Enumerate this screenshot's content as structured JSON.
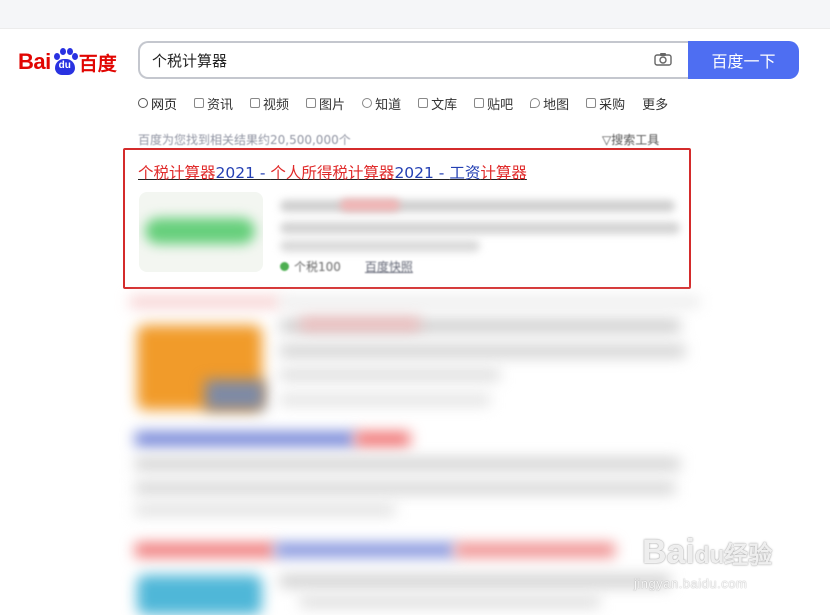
{
  "brand": {
    "logo_latin": "Bai",
    "logo_du": "du",
    "logo_cn": "百度",
    "primary_color": "#4e6ef2",
    "logo_red": "#e10602",
    "logo_blue": "#2932e1"
  },
  "search": {
    "query": "个税计算器",
    "button_label": "百度一下",
    "camera_icon": "camera-icon"
  },
  "tabs": [
    {
      "label": "网页",
      "icon": "search-icon",
      "active": true
    },
    {
      "label": "资讯",
      "icon": "news-icon"
    },
    {
      "label": "视频",
      "icon": "video-icon"
    },
    {
      "label": "图片",
      "icon": "image-icon"
    },
    {
      "label": "知道",
      "icon": "question-icon"
    },
    {
      "label": "文库",
      "icon": "document-icon"
    },
    {
      "label": "贴吧",
      "icon": "tieba-icon"
    },
    {
      "label": "地图",
      "icon": "map-pin-icon"
    },
    {
      "label": "采购",
      "icon": "basket-icon"
    },
    {
      "label": "更多"
    }
  ],
  "results": {
    "stats": "百度为您找到相关结果约20,500,000个",
    "tools_label": "搜索工具",
    "first": {
      "title_parts": [
        {
          "text": "个税计算器",
          "color": "red"
        },
        {
          "text": "2021 - ",
          "color": "blue"
        },
        {
          "text": "个人所得税计算器",
          "color": "red"
        },
        {
          "text": "2021 - ",
          "color": "blue"
        },
        {
          "text": "工资",
          "color": "blue"
        },
        {
          "text": "计算器",
          "color": "red"
        }
      ],
      "source": "个税100",
      "snapshot": "百度快照",
      "highlight_color": "#d42b2b"
    }
  },
  "watermark": {
    "logo": "Bai",
    "logo_du": "du",
    "logo_cn": "经验",
    "url": "jingyan.baidu.com"
  }
}
